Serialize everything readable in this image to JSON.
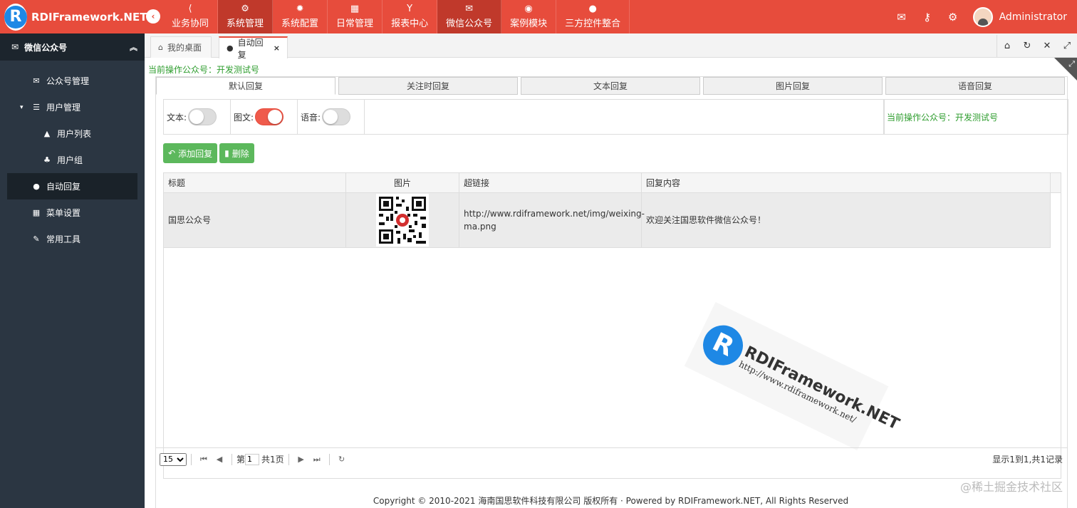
{
  "app": {
    "logo_letter": "R",
    "name": "RDIFramework.NET",
    "user": "Administrator"
  },
  "nav": [
    {
      "icon": "share-icon",
      "glyph": "⟨",
      "label": "业务协同",
      "active": false
    },
    {
      "icon": "gears-icon",
      "glyph": "⚙",
      "label": "系统管理",
      "active": true
    },
    {
      "icon": "gear-icon",
      "glyph": "✹",
      "label": "系统配置",
      "active": false
    },
    {
      "icon": "calendar-icon",
      "glyph": "▦",
      "label": "日常管理",
      "active": false
    },
    {
      "icon": "filter-icon",
      "glyph": "Y",
      "label": "报表中心",
      "active": false
    },
    {
      "icon": "wechat-icon",
      "glyph": "✉",
      "label": "微信公众号",
      "active": true
    },
    {
      "icon": "eye-icon",
      "glyph": "◉",
      "label": "案例模块",
      "active": false
    },
    {
      "icon": "globe-icon",
      "glyph": "●",
      "label": "三方控件整合",
      "active": false
    }
  ],
  "sidebar": {
    "header": "微信公众号",
    "items": [
      {
        "label": "公众号管理",
        "glyph": "✉",
        "sub": false
      },
      {
        "label": "用户管理",
        "glyph": "☰",
        "sub": false,
        "caret": "▾"
      },
      {
        "label": "用户列表",
        "glyph": "▲",
        "sub": true
      },
      {
        "label": "用户组",
        "glyph": "♣",
        "sub": true
      },
      {
        "label": "自动回复",
        "glyph": "●",
        "sub": false,
        "active": true
      },
      {
        "label": "菜单设置",
        "glyph": "▦",
        "sub": false
      },
      {
        "label": "常用工具",
        "glyph": "✎",
        "sub": false
      }
    ]
  },
  "tabs": [
    {
      "label": "我的桌面",
      "glyph": "⌂"
    },
    {
      "label": "自动回复",
      "glyph": "●",
      "close": "×",
      "active": true
    }
  ],
  "current_account": "当前操作公众号：开发测试号",
  "subtabs": [
    "默认回复",
    "关注时回复",
    "文本回复",
    "图片回复",
    "语音回复"
  ],
  "switches": [
    {
      "label": "文本:",
      "on": false
    },
    {
      "label": "图文:",
      "on": true
    },
    {
      "label": "语音:",
      "on": false
    }
  ],
  "switch_account": "当前操作公众号：开发测试号",
  "buttons": {
    "add": "添加回复",
    "delete": "删除"
  },
  "grid": {
    "columns": [
      "标题",
      "图片",
      "超链接",
      "回复内容"
    ],
    "rows": [
      {
        "title": "国思公众号",
        "link": "http://www.rdiframework.net/img/weixing-ma.png",
        "content": "欢迎关注国思软件微信公众号！"
      }
    ]
  },
  "pager": {
    "size": "15",
    "page_prefix": "第",
    "page": "1",
    "total_pages": "共1页",
    "info": "显示1到1,共1记录"
  },
  "watermark": {
    "title": "RDIFramework.NET",
    "url": "http://www.rdiframework.net/"
  },
  "footer": "Copyright © 2010-2021 海南国思软件科技有限公司 版权所有 · Powered by RDIFramework.NET, All Rights Reserved",
  "corner_watermark": "@稀土掘金技术社区"
}
